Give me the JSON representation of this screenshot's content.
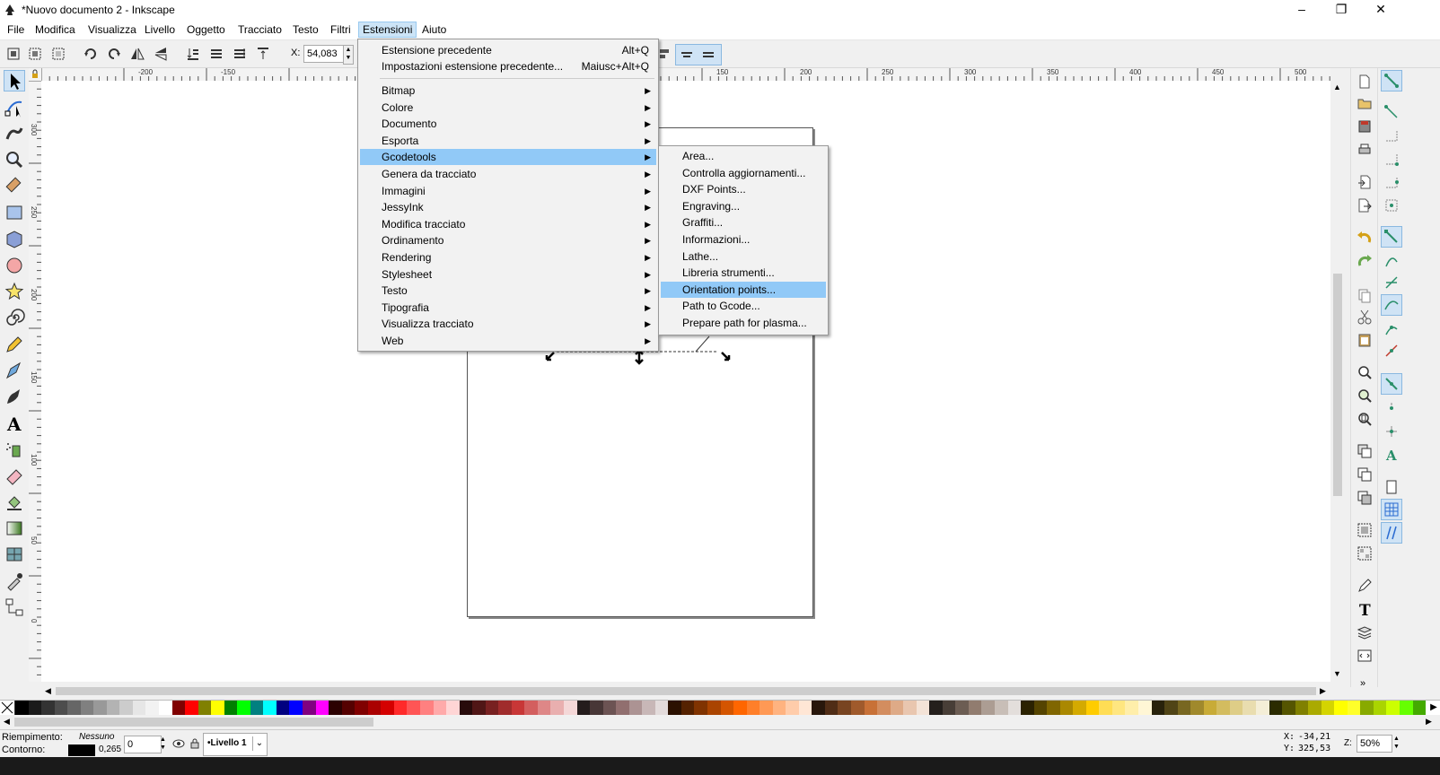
{
  "window": {
    "title": "*Nuovo documento 2 - Inkscape"
  },
  "menubar": [
    "File",
    "Modifica",
    "Visualizza",
    "Livello",
    "Oggetto",
    "Tracciato",
    "Testo",
    "Filtri",
    "Estensioni",
    "Aiuto"
  ],
  "toolbar": {
    "x_label": "X:",
    "x_value": "54,083"
  },
  "ruler": {
    "h_labels": [
      "-200",
      "-150",
      "150",
      "200",
      "250",
      "300",
      "350",
      "400",
      "450",
      "500"
    ],
    "v_labels": [
      "300",
      "250",
      "200",
      "150",
      "100",
      "50",
      "0"
    ]
  },
  "extensions_menu": {
    "items": [
      {
        "label": "Estensione precedente",
        "accel": "Alt+Q"
      },
      {
        "label": "Impostazioni estensione precedente...",
        "accel": "Maiusc+Alt+Q"
      }
    ],
    "submenus": [
      "Bitmap",
      "Colore",
      "Documento",
      "Esporta",
      "Gcodetools",
      "Genera da tracciato",
      "Immagini",
      "JessyInk",
      "Modifica tracciato",
      "Ordinamento",
      "Rendering",
      "Stylesheet",
      "Testo",
      "Tipografia",
      "Visualizza tracciato",
      "Web"
    ],
    "highlighted": "Gcodetools"
  },
  "gcodetools_menu": {
    "items": [
      "Area...",
      "Controlla aggiornamenti...",
      "DXF Points...",
      "Engraving...",
      "Graffiti...",
      "Informazioni...",
      "Lathe...",
      "Libreria strumenti...",
      "Orientation points...",
      "Path to Gcode...",
      "Prepare path for plasma..."
    ],
    "highlighted": "Orientation points..."
  },
  "status": {
    "fill_label": "Riempimento:",
    "fill_value": "Nessuno",
    "stroke_label": "Contorno:",
    "stroke_width": "0,265",
    "opacity": "0",
    "layer": "•Livello 1",
    "x_label": "X:",
    "x_value": "-34,21",
    "y_label": "Y:",
    "y_value": "325,53",
    "zoom_label": "Z:",
    "zoom_value": "50%"
  },
  "palette_colors": [
    "#000000",
    "#1a1a1a",
    "#333333",
    "#4d4d4d",
    "#666666",
    "#808080",
    "#999999",
    "#b3b3b3",
    "#cccccc",
    "#e6e6e6",
    "#f2f2f2",
    "#ffffff",
    "#800000",
    "#ff0000",
    "#808000",
    "#ffff00",
    "#008000",
    "#00ff00",
    "#008080",
    "#00ffff",
    "#000080",
    "#0000ff",
    "#800080",
    "#ff00ff",
    "#2b0000",
    "#550000",
    "#800000",
    "#aa0000",
    "#d40000",
    "#ff2a2a",
    "#ff5555",
    "#ff8080",
    "#ffaaaa",
    "#ffd5d5",
    "#280b0b",
    "#501616",
    "#782121",
    "#a02c2c",
    "#c83737",
    "#d35f5f",
    "#de8787",
    "#e9afaf",
    "#f4d7d7",
    "#241c1c",
    "#483737",
    "#6c5353",
    "#916f6f",
    "#ac9393",
    "#c8b7b7",
    "#e3dbdb",
    "#2b1100",
    "#552200",
    "#803300",
    "#aa4400",
    "#d45500",
    "#ff6600",
    "#ff7f2a",
    "#ff9955",
    "#ffb380",
    "#ffccaa",
    "#ffe6d5",
    "#28170b",
    "#502d16",
    "#784421",
    "#a05a2c",
    "#c87137",
    "#d38d5f",
    "#deaa87",
    "#e9c6af",
    "#f4e3d7",
    "#241f1c",
    "#483e37",
    "#6c5d53",
    "#917c6f",
    "#ac9d93",
    "#c8beb7",
    "#e3dedb",
    "#2b2200",
    "#554400",
    "#806600",
    "#aa8800",
    "#d4aa00",
    "#ffcc00",
    "#ffdd55",
    "#ffe680",
    "#ffeeaa",
    "#fff6d5",
    "#28220b",
    "#504416",
    "#786721",
    "#a0892c",
    "#c8ab37",
    "#d3bc5f",
    "#decd87",
    "#e9ddaf",
    "#f4eed7",
    "#2b2b00",
    "#555500",
    "#808000",
    "#aaaa00",
    "#d4d400",
    "#ffff00",
    "#ffff2a",
    "#88aa00",
    "#aad400",
    "#ccff00",
    "#66ff00",
    "#44aa00"
  ]
}
